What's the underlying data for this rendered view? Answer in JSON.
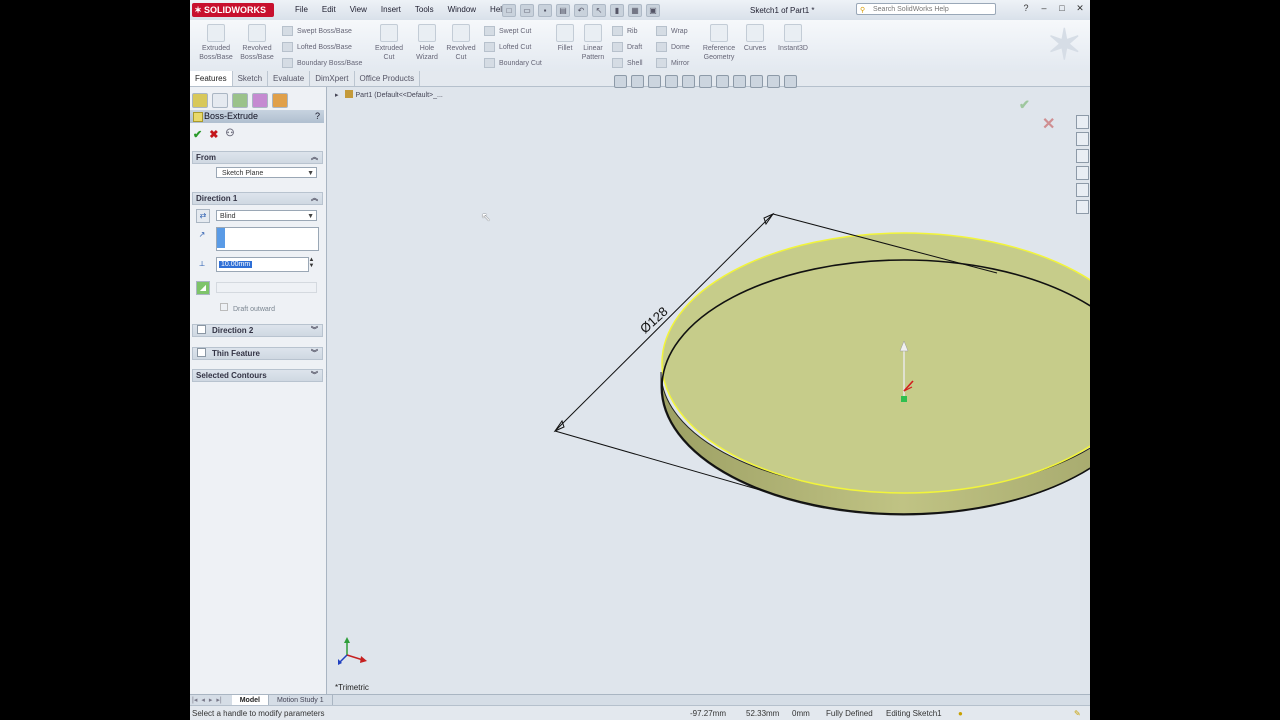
{
  "window": {
    "brand": "SOLIDWORKS",
    "menu": [
      "File",
      "Edit",
      "View",
      "Insert",
      "Tools",
      "Window",
      "Help"
    ],
    "doc_title": "Sketch1 of Part1 *",
    "search_placeholder": "Search SolidWorks Help"
  },
  "command_manager": {
    "big_buttons": [
      "Extruded Boss/Base",
      "Revolved Boss/Base",
      "Extruded Cut",
      "Hole Wizard",
      "Revolved Cut",
      "Fillet",
      "Linear Pattern",
      "Reference Geometry",
      "Curves",
      "Instant3D"
    ],
    "small_buttons": [
      "Swept Boss/Base",
      "Lofted Boss/Base",
      "Boundary Boss/Base",
      "Swept Cut",
      "Lofted Cut",
      "Boundary Cut",
      "Rib",
      "Draft",
      "Shell",
      "Wrap",
      "Dome",
      "Mirror"
    ]
  },
  "tabs": [
    "Features",
    "Sketch",
    "Evaluate",
    "DimXpert",
    "Office Products"
  ],
  "active_tab": "Features",
  "property_manager": {
    "title": "Boss-Extrude",
    "help": "?",
    "from_label": "From",
    "from_value": "Sketch Plane",
    "direction1_label": "Direction 1",
    "end_condition": "Blind",
    "depth_value": "10.00mm",
    "draft_outward": "Draft outward",
    "direction2_label": "Direction 2",
    "thin_feature_label": "Thin Feature",
    "selected_contours_label": "Selected Contours"
  },
  "viewport": {
    "tree_root": "Part1  (Default<<Default>_...",
    "dimension_label": "Ø128",
    "view_orientation": "*Trimetric"
  },
  "bottom_tabs": [
    "Model",
    "Motion Study 1"
  ],
  "status_bar": {
    "message": "Select a handle to modify parameters",
    "x": "-97.27mm",
    "y": "52.33mm",
    "z": "0mm",
    "state": "Fully Defined",
    "mode": "Editing Sketch1"
  },
  "colors": {
    "disc_top": "#c6cc8a",
    "disc_side": "#b0b273",
    "highlight": "#f2f53a",
    "viewport_bg": "#dfe5ec"
  }
}
